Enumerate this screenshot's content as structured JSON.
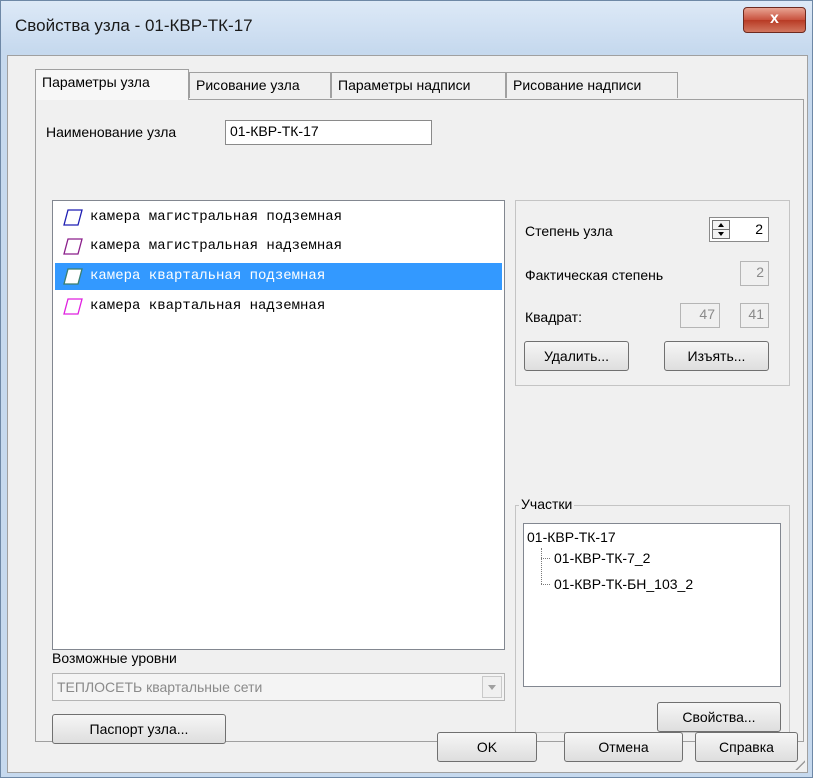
{
  "window": {
    "title": "Свойства узла - 01-КВР-ТК-17",
    "close_label": "x"
  },
  "tabs": [
    {
      "label": "Параметры узла",
      "active": true
    },
    {
      "label": "Рисование узла",
      "active": false
    },
    {
      "label": "Параметры надписи",
      "active": false
    },
    {
      "label": "Рисование надписи",
      "active": false
    }
  ],
  "node_name": {
    "label": "Наименование узла",
    "value": "01-КВР-ТК-17"
  },
  "types_list": {
    "items": [
      {
        "label": "камера магистральная подземная",
        "color": "#1f1fb3",
        "selected": false
      },
      {
        "label": "камера магистральная надземная",
        "color": "#8a1f8a",
        "selected": false
      },
      {
        "label": "камера квартальная подземная",
        "color": "#3b7f6f",
        "selected": true
      },
      {
        "label": "камера квартальная надземная",
        "color": "#e020e0",
        "selected": false
      }
    ]
  },
  "levels": {
    "label": "Возможные уровни",
    "selected": "ТЕПЛОСЕТЬ квартальные сети"
  },
  "passport_button": "Паспорт узла...",
  "props_group": {
    "degree_label": "Степень узла",
    "degree_value": "2",
    "actual_degree_label": "Фактическая степень",
    "actual_degree_value": "2",
    "square_label": "Квадрат:",
    "square_x": "47",
    "square_y": "41",
    "delete_button": "Удалить...",
    "withdraw_button": "Изъять..."
  },
  "sections": {
    "label": "Участки",
    "root": "01-КВР-ТК-17",
    "children": [
      "01-КВР-ТК-7_2",
      "01-КВР-ТК-БН_103_2"
    ],
    "properties_button": "Свойства..."
  },
  "footer": {
    "ok": "OK",
    "cancel": "Отмена",
    "help": "Справка"
  },
  "colors": {
    "selection": "#3399ff",
    "title_bg": "#c6d9ee",
    "close_button": "#c8513d"
  }
}
